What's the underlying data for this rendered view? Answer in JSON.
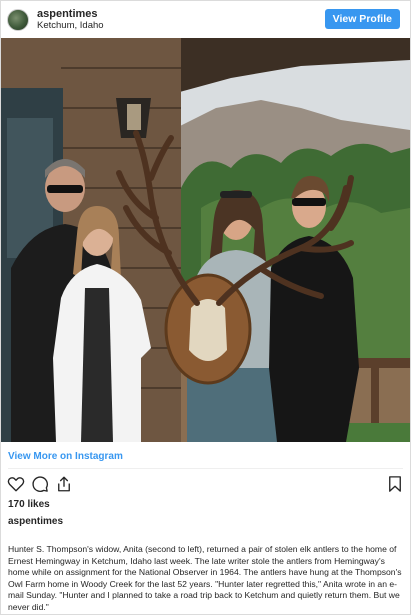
{
  "header": {
    "username": "aspentimes",
    "location": "Ketchum, Idaho",
    "view_profile_label": "View Profile"
  },
  "post": {
    "view_more_label": "View More on Instagram",
    "likes_text": "170 likes",
    "caption_username": "aspentimes",
    "caption_text": "Hunter S. Thompson's widow, Anita (second to left), returned a pair of stolen elk antlers to the home of Ernest Hemingway in Ketchum, Idaho last week. The late writer stole the antlers from Hemingway's home while on assignment for the National Observer in 1964. The antlers have hung at the Thompson's Owl Farm home in Woody Creek for the last 52 years. \"Hunter later regretted this,\" Anita wrote in an e-mail Sunday. \"Hunter and I planned to take a road trip back to Ketchum and quietly return them. But we never did.\""
  },
  "icons": [
    "heart-icon",
    "comment-icon",
    "share-icon",
    "bookmark-icon"
  ],
  "colors": {
    "accent": "#3897f0",
    "text": "#262626",
    "border": "#dbdbdb"
  }
}
